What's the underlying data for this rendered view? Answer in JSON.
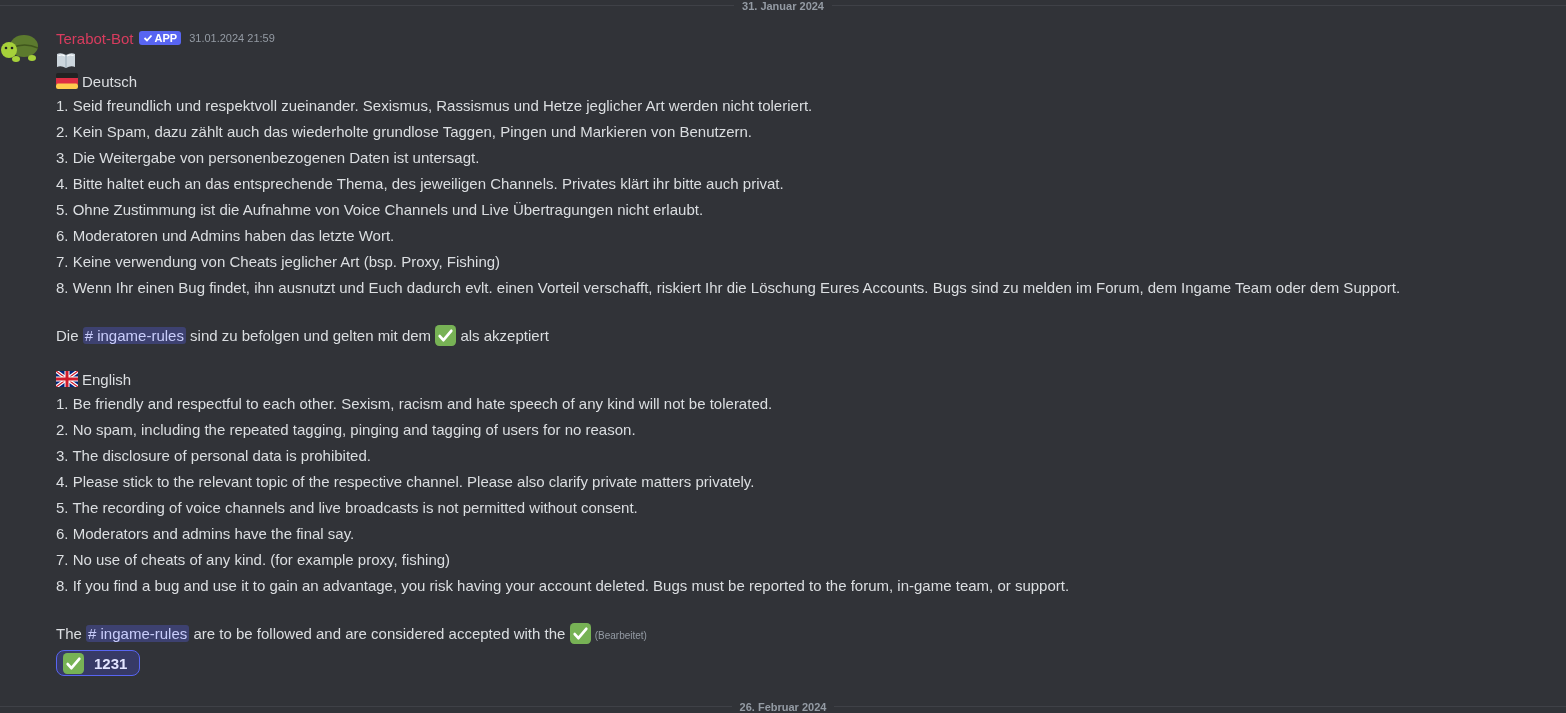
{
  "top_divider": {
    "label": "31. Januar 2024"
  },
  "message": {
    "author": "Terabot-Bot",
    "badge": "APP",
    "timestamp": "31.01.2024 21:59",
    "sections": [
      {
        "kind": "de",
        "heading": "Deutsch",
        "rules": [
          "1. Seid freundlich und respektvoll zueinander. Sexismus, Rassismus und Hetze jeglicher Art werden nicht toleriert.",
          "2. Kein Spam, dazu zählt auch das wiederholte grundlose Taggen, Pingen und Markieren von Benutzern.",
          "3. Die Weitergabe von personenbezogenen Daten ist untersagt.",
          "4. Bitte haltet euch an das entsprechende Thema, des jeweiligen Channels. Privates klärt ihr bitte auch privat.",
          "5. Ohne Zustimmung ist die Aufnahme von Voice Channels und Live Übertragungen nicht erlaubt.",
          "6. Moderatoren und Admins haben das letzte Wort.",
          "7. Keine verwendung von Cheats jeglicher Art (bsp. Proxy, Fishing)",
          "8. Wenn Ihr einen Bug findet, ihn ausnutzt und Euch dadurch evlt. einen Vorteil verschafft, riskiert Ihr die Löschung Eures Accounts. Bugs sind zu melden im Forum, dem Ingame Team oder dem Support."
        ],
        "footer": [
          {
            "kind": "text",
            "text": "Die"
          },
          {
            "kind": "channel",
            "text": "# ingame-rules"
          },
          {
            "kind": "text",
            "text": "sind zu befolgen und gelten mit dem"
          },
          {
            "kind": "emoji"
          },
          {
            "kind": "text",
            "text": "als akzeptiert"
          }
        ]
      },
      {
        "kind": "gb",
        "heading": "English",
        "rules": [
          "1. Be friendly and respectful to each other. Sexism, racism and hate speech of any kind will not be tolerated.",
          "2. No spam, including the repeated tagging, pinging and tagging of users for no reason.",
          "3. The disclosure of personal data is prohibited.",
          "4. Please stick to the relevant topic of the respective channel. Please also clarify private matters privately.",
          "5. The recording of voice channels and live broadcasts is not permitted without consent.",
          "6. Moderators and admins have the final say.",
          "7. No use of cheats of any kind. (for example proxy, fishing)",
          "8. If you find a bug and use it to gain an advantage, you risk having your account deleted. Bugs must be reported to the forum, in-game team, or support."
        ],
        "footer": [
          {
            "kind": "text",
            "text": "The"
          },
          {
            "kind": "channel",
            "text": "# ingame-rules"
          },
          {
            "kind": "text",
            "text": "are to be followed and are considered accepted with the"
          },
          {
            "kind": "emoji"
          },
          {
            "kind": "edited",
            "text": "(Bearbeitet)"
          }
        ]
      }
    ],
    "reactions": [
      {
        "count": "1231",
        "selected": true
      }
    ]
  },
  "bottom_divider": {
    "label": "26. Februar 2024"
  }
}
